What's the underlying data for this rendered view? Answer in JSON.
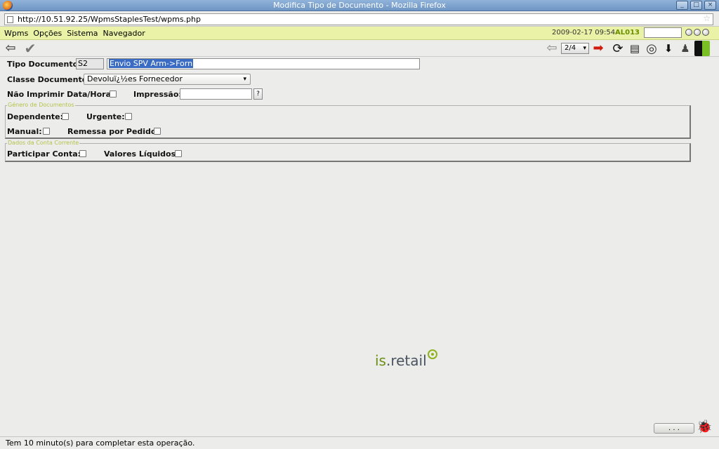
{
  "window": {
    "title": "Modifica Tipo de Documento - Mozilla Firefox",
    "controls": [
      "_",
      "□",
      "×"
    ]
  },
  "browser": {
    "url": "http://10.51.92.25/WpmsStaplesTest/wpms.php"
  },
  "menubar": {
    "items": [
      "Wpms",
      "Opções",
      "Sistema",
      "Navegador"
    ],
    "datetime": "2009-02-17 09:54",
    "user": "AL013"
  },
  "toolbar": {
    "pager": "2/4"
  },
  "form": {
    "tipo_documento_label": "Tipo Documento:",
    "tipo_documento_code": "S2",
    "tipo_documento_desc": "Envio SPV Arm->Forn",
    "classe_documento_label": "Classe Documento:",
    "classe_documento_value": "Devoluï¿½es Fornecedor",
    "nao_imprimir_label": "Não Imprimir Data/Hora:",
    "impressao_label": "Impressão:",
    "impressao_value": "",
    "impressao_help": "?",
    "genero_group": {
      "legend": "Género de Documentos",
      "dependente_label": "Dependente:",
      "urgente_label": "Urgente:",
      "manual_label": "Manual:",
      "remessa_label": "Remessa por Pedido:"
    },
    "conta_group": {
      "legend": "Dados da Conta Corrente",
      "participar_label": "Participar Conta:",
      "valores_label": "Valores Líquidos:"
    }
  },
  "logo": {
    "prefix": "is",
    "suffix": ".retail"
  },
  "footer": {
    "more_button": ". . .",
    "status": "Tem 10 minuto(s) para completar esta operação."
  }
}
